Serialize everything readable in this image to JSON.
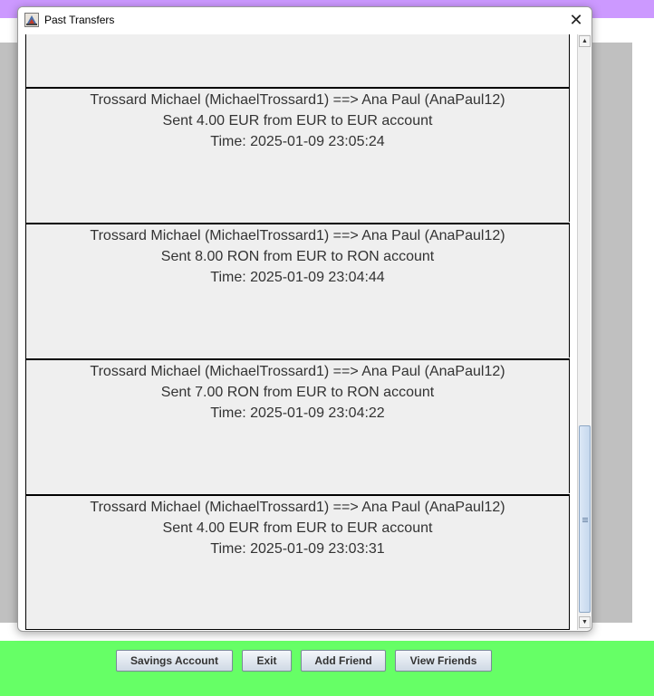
{
  "window": {
    "title": "Past Transfers",
    "close_glyph": "✕"
  },
  "transfers": [
    {
      "parties": "Trossard Michael (MichaelTrossard1) ==> Ana Paul (AnaPaul12)",
      "sent": "Sent 4.00 EUR from EUR to EUR account",
      "time": "Time: 2025-01-09 23:05:24"
    },
    {
      "parties": "Trossard Michael (MichaelTrossard1) ==> Ana Paul (AnaPaul12)",
      "sent": "Sent 8.00 RON from EUR to RON account",
      "time": "Time: 2025-01-09 23:04:44"
    },
    {
      "parties": "Trossard Michael (MichaelTrossard1) ==> Ana Paul (AnaPaul12)",
      "sent": "Sent 7.00 RON from EUR to RON account",
      "time": "Time: 2025-01-09 23:04:22"
    },
    {
      "parties": "Trossard Michael (MichaelTrossard1) ==> Ana Paul (AnaPaul12)",
      "sent": "Sent 4.00 EUR from EUR to EUR account",
      "time": "Time: 2025-01-09 23:03:31"
    }
  ],
  "bottom_bar": {
    "savings_label": "Savings Account",
    "exit_label": "Exit",
    "add_friend_label": "Add Friend",
    "view_friends_label": "View Friends"
  },
  "scroll": {
    "position_fraction": 1.0
  },
  "colors": {
    "top_band": "#cc99ff",
    "bottom_band": "#66ff66",
    "side_panel": "#c0c0c0"
  }
}
